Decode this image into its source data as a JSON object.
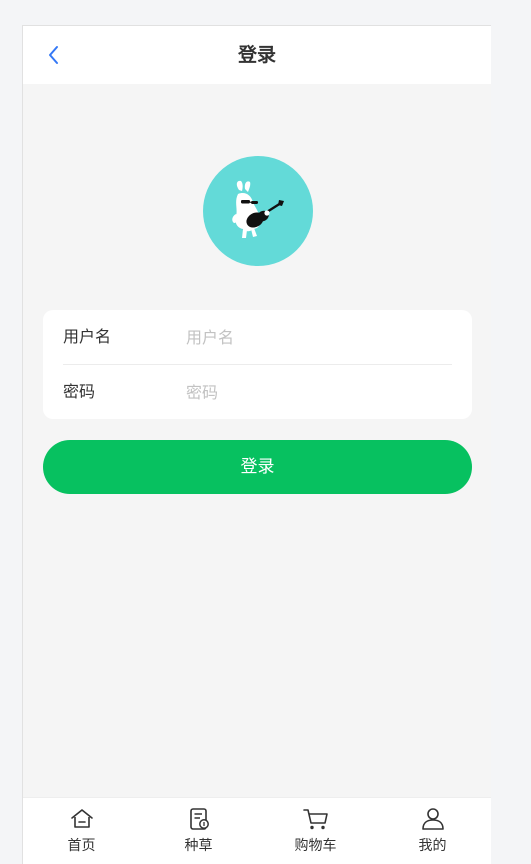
{
  "navbar": {
    "title": "登录",
    "back_icon": "chevron-left-icon",
    "back_color": "#3478f6"
  },
  "avatar": {
    "icon": "guitar-rabbit-avatar",
    "bg_color": "#63dad8"
  },
  "form": {
    "username_label": "用户名",
    "username_placeholder": "用户名",
    "username_value": "",
    "password_label": "密码",
    "password_placeholder": "密码",
    "password_value": ""
  },
  "login_button": {
    "label": "登录",
    "color": "#07c160"
  },
  "tabbar": {
    "items": [
      {
        "label": "首页",
        "icon": "home-icon"
      },
      {
        "label": "种草",
        "icon": "note-icon"
      },
      {
        "label": "购物车",
        "icon": "cart-icon"
      },
      {
        "label": "我的",
        "icon": "user-icon"
      }
    ]
  }
}
